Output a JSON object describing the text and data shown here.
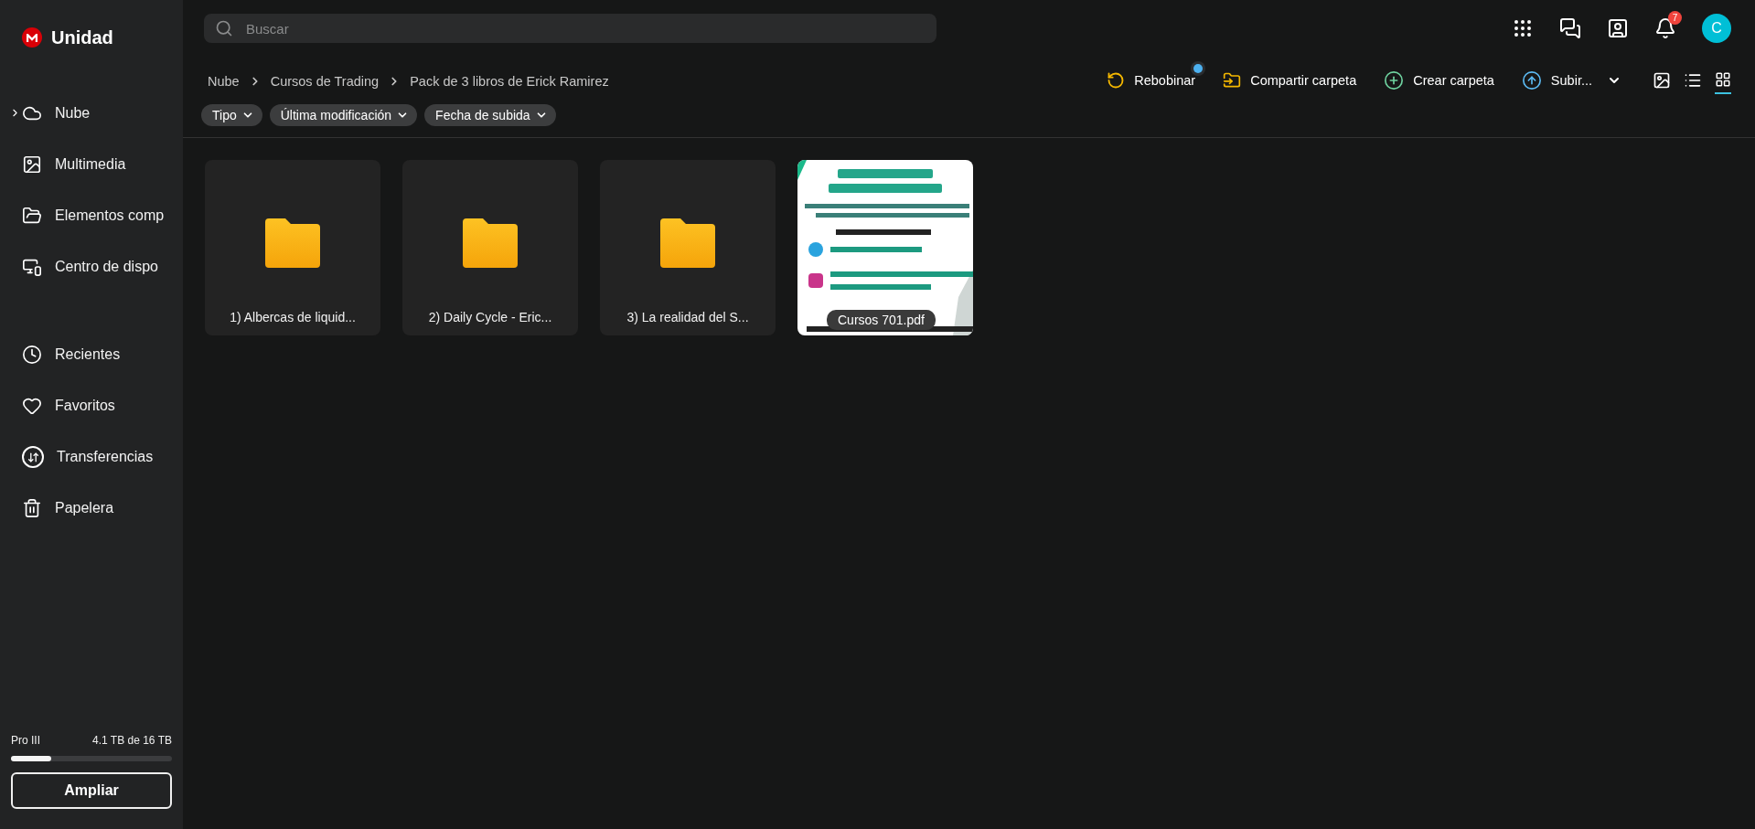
{
  "brand": {
    "title": "Unidad"
  },
  "sidebar": {
    "groups": [
      [
        {
          "label": "Nube",
          "kind": "cloud",
          "expanded": false
        },
        {
          "label": "Multimedia",
          "kind": "media"
        },
        {
          "label": "Elementos comp",
          "kind": "shared"
        },
        {
          "label": "Centro de dispo",
          "kind": "devices"
        }
      ],
      [
        {
          "label": "Recientes",
          "kind": "recent"
        },
        {
          "label": "Favoritos",
          "kind": "favorites"
        },
        {
          "label": "Transferencias",
          "kind": "transfers"
        },
        {
          "label": "Papelera",
          "kind": "trash"
        }
      ]
    ],
    "storage": {
      "plan": "Pro III",
      "usage": "4.1 TB de 16 TB",
      "level": 0.25
    },
    "upgrade_button": "Ampliar"
  },
  "search": {
    "placeholder": "Buscar"
  },
  "header_icons": [
    {
      "kind": "apps"
    },
    {
      "kind": "chat"
    },
    {
      "kind": "contacts"
    },
    {
      "kind": "notifications",
      "badge": "7"
    },
    {
      "kind": "avatar",
      "initial": "C"
    }
  ],
  "breadcrumbs": [
    "Nube",
    "Cursos de Trading",
    "Pack de 3 libros de Erick Ramirez"
  ],
  "actions": [
    {
      "label": "Rebobinar",
      "kind": "rewind",
      "dot": true
    },
    {
      "label": "Compartir carpeta",
      "kind": "share"
    },
    {
      "label": "Crear carpeta",
      "kind": "create"
    },
    {
      "label": "Subir...",
      "kind": "upload"
    }
  ],
  "views": [
    {
      "kind": "thumbnail",
      "selected": false
    },
    {
      "kind": "list",
      "selected": false
    },
    {
      "kind": "grid",
      "selected": true
    }
  ],
  "filters": [
    "Tipo",
    "Última modificación",
    "Fecha de subida"
  ],
  "items": [
    {
      "kind": "folder",
      "name": "1) Albercas de liquid..."
    },
    {
      "kind": "folder",
      "name": "2) Daily Cycle - Eric..."
    },
    {
      "kind": "folder",
      "name": "3) La realidad del S..."
    },
    {
      "kind": "file",
      "name": "Cursos 701.pdf"
    }
  ]
}
